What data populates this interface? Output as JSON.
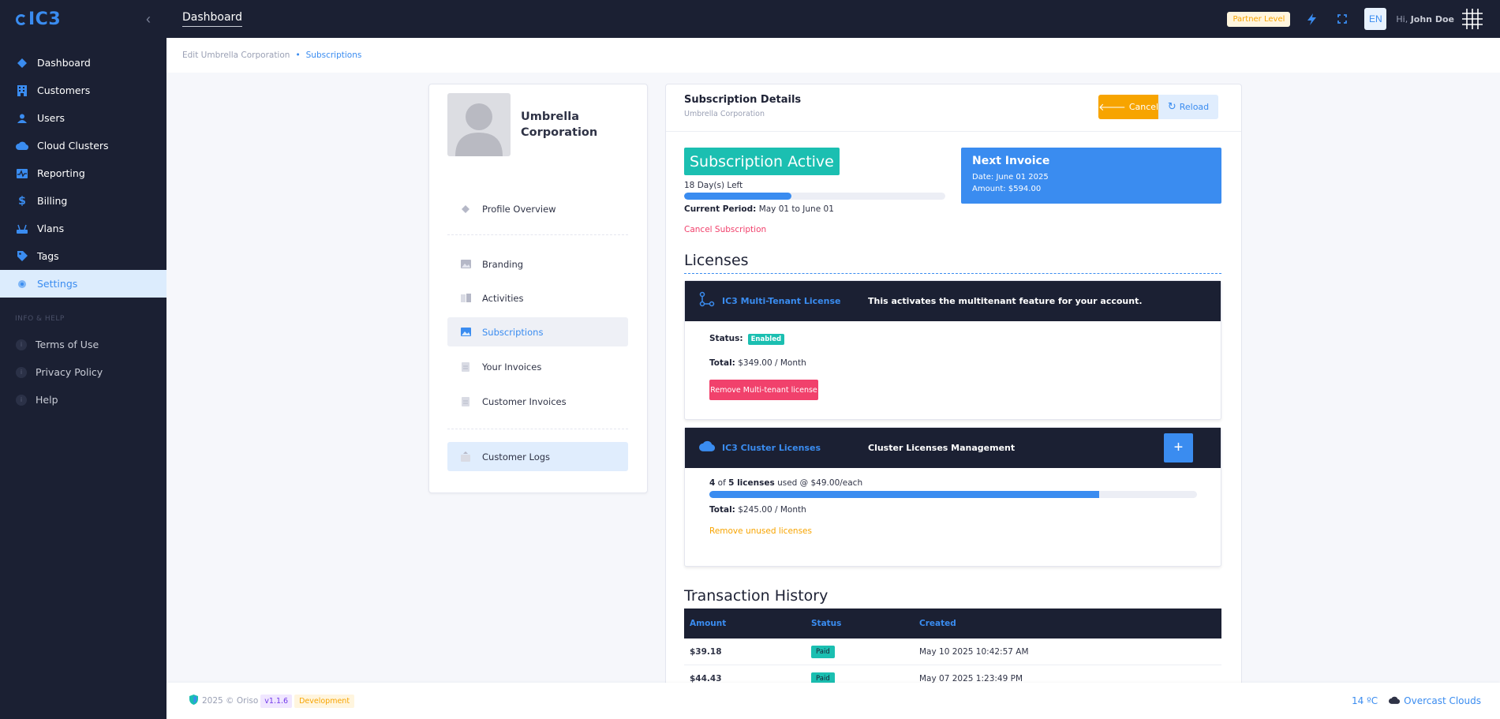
{
  "app": {
    "logo": "IC3",
    "title": "Dashboard"
  },
  "sidebar": {
    "items": [
      {
        "label": "Dashboard",
        "icon": "diamond-icon"
      },
      {
        "label": "Customers",
        "icon": "building-icon"
      },
      {
        "label": "Users",
        "icon": "user-icon"
      },
      {
        "label": "Cloud Clusters",
        "icon": "cloud-icon"
      },
      {
        "label": "Reporting",
        "icon": "pulse-icon"
      },
      {
        "label": "Billing",
        "icon": "dollar-icon"
      },
      {
        "label": "Vlans",
        "icon": "router-icon"
      },
      {
        "label": "Tags",
        "icon": "tag-icon"
      },
      {
        "label": "Settings",
        "icon": "gear-icon"
      }
    ],
    "section_label": "INFO & HELP",
    "help_items": [
      "Terms of Use",
      "Privacy Policy",
      "Help"
    ]
  },
  "topbar": {
    "partner_label": "Partner Level",
    "language": "EN",
    "greeting": "Hi,",
    "user_name": "John Doe"
  },
  "breadcrumb": {
    "parent": "Edit Umbrella Corporation",
    "current": "Subscriptions"
  },
  "profile": {
    "company_name": "Umbrella Corporation",
    "nav": [
      "Profile Overview",
      "Branding",
      "Activities",
      "Subscriptions",
      "Your Invoices",
      "Customer Invoices",
      "Customer Logs"
    ]
  },
  "subscription": {
    "title": "Subscription Details",
    "subtitle": "Umbrella Corporation",
    "cancel_label": "Cancel",
    "reload_label": "Reload",
    "status_label": "Subscription Active",
    "days_left": "18 Day(s) Left",
    "progress_fraction": 0.41,
    "period_label": "Current Period:",
    "period_value": "May 01 to June 01",
    "cancel_link": "Cancel Subscription"
  },
  "next_invoice": {
    "title": "Next Invoice",
    "date": "Date: June 01 2025",
    "amount": "Amount: $594.00"
  },
  "licenses": {
    "title": "Licenses",
    "multitenant": {
      "name": "IC3 Multi-Tenant License",
      "description": "This activates the multitenant feature for your account.",
      "status_label": "Status:",
      "status_value": "Enabled",
      "total_label": "Total:",
      "total_value": "$349.00 / Month",
      "remove_label": "Remove Multi-tenant license"
    },
    "cluster": {
      "name": "IC3 Cluster Licenses",
      "description": "Cluster Licenses Management",
      "add_label": "+",
      "used": "4",
      "of_text": "of",
      "total_count": "5 licenses",
      "used_text": "used @ $49.00/each",
      "used_fraction": 0.8,
      "total_label": "Total:",
      "total_value": "$245.00 / Month",
      "remove_unused": "Remove unused licenses"
    }
  },
  "transactions": {
    "title": "Transaction History",
    "columns": [
      "Amount",
      "Status",
      "Created"
    ],
    "rows": [
      {
        "amount": "$39.18",
        "status": "Paid",
        "created": "May 10 2025 10:42:57 AM"
      },
      {
        "amount": "$44.43",
        "status": "Paid",
        "created": "May 07 2025 1:23:49 PM"
      }
    ]
  },
  "footer": {
    "copyright": "2025 © Oriso",
    "version": "v1.1.6",
    "environment": "Development",
    "temperature": "14 ºC",
    "weather": "Overcast Clouds"
  },
  "colors": {
    "sidebar_bg": "#1b2033",
    "accent": "#3a8cf0",
    "success": "#1bbfb1",
    "warning": "#f7a400",
    "danger": "#f1416c"
  }
}
